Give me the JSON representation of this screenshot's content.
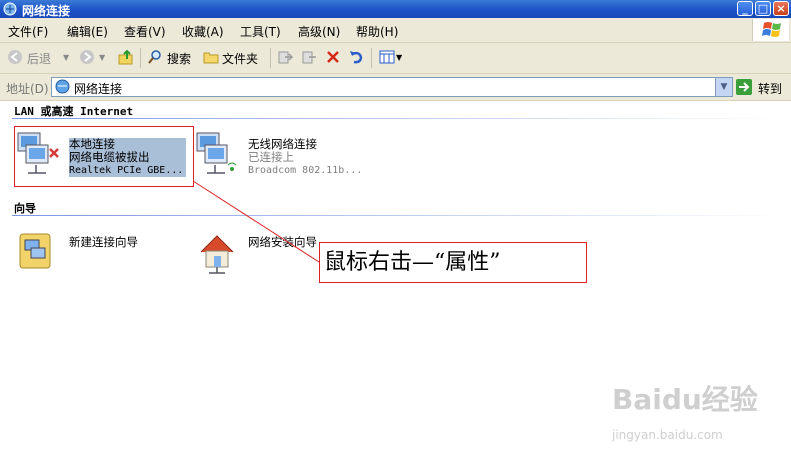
{
  "window": {
    "title": "网络连接",
    "min": "_",
    "max": "□",
    "close": "×"
  },
  "menu": [
    "文件(F)",
    "编辑(E)",
    "查看(V)",
    "收藏(A)",
    "工具(T)",
    "高级(N)",
    "帮助(H)"
  ],
  "toolbar": {
    "back": "后退",
    "search": "搜索",
    "folders": "文件夹"
  },
  "address": {
    "label": "地址(D)",
    "value": "网络连接",
    "go": "转到"
  },
  "groups": {
    "lan": "LAN 或高速 Internet",
    "wizard": "向导"
  },
  "connections": [
    {
      "name": "本地连接",
      "status": "网络电缆被拔出",
      "device": "Realtek PCIe GBE..."
    },
    {
      "name": "无线网络连接",
      "status": "已连接上",
      "device": "Broadcom 802.11b..."
    }
  ],
  "wizards": [
    {
      "name": "新建连接向导"
    },
    {
      "name": "网络安装向导"
    }
  ],
  "annotation": {
    "text": "鼠标右击—“属性”"
  },
  "watermark": {
    "brand": "Baidu经验",
    "url": "jingyan.baidu.com"
  }
}
